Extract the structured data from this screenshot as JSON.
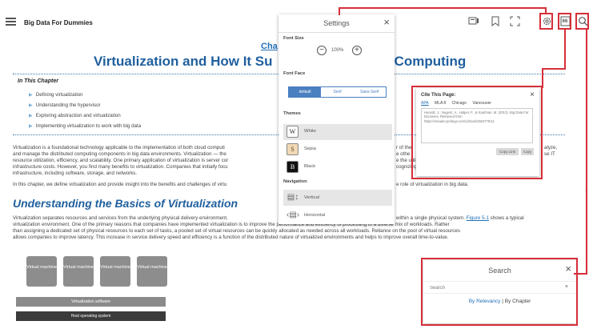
{
  "topbar": {
    "book_title": "Big Data For Dummies",
    "icons": [
      "slides-icon",
      "bookmark-icon",
      "fullscreen-icon",
      "settings-gear-icon",
      "cite-icon",
      "search-icon"
    ],
    "cite_icon_text": "66"
  },
  "chapter": {
    "link_text": "Cha",
    "title": "Virtualization and How It Su",
    "title_tail": "Computing",
    "in_this_chapter": "In This Chapter",
    "toc": [
      "Defining virtualization",
      "Understanding the hypervisor",
      "Exploring abstraction and virtualization",
      "Implementing virtualization to work with big data"
    ],
    "para1": [
      "Virtualization is a foundational technology applicable to the implementation of both cloud computi",
      "and manage the distributed computing components in big data environments. Virtualization — the",
      "resource utilization, efficiency, and scalability. One primary application of virtualization is server cor",
      "infrastructure costs. However, you find many benefits to virtualization. Companies that initially focu",
      "infrastructure, including software, storage, and networks."
    ],
    "para1_right": [
      "r of the",
      "e othe",
      "e the utilization of physical servers and potentially save on",
      "cognizing that it can be applied across the entire IT",
      ""
    ],
    "para1_far_right": [
      "alyze,",
      "se IT",
      "",
      "",
      ""
    ],
    "para2_left": "In this chapter, we define virtualization and provide insight into the benefits and challenges of virtu",
    "para2_right": "e role of virtualization in big data.",
    "section_heading": "Understanding the Basics of Virtualization",
    "para3": [
      "Virtualization separates resources and services from the underlying physical delivery environment.",
      "virtualization environment. One of the primary reasons that companies have implemented virtualization is to improve the performance and efficiency of processing of a diverse mix of workloads. Rather",
      "than assigning a dedicated set of physical resources to each set of tasks, a pooled set of virtual resources can be quickly allocated as needed across all workloads. Reliance on the pool of virtual resources",
      "allows companies to improve latency. This increase in service delivery speed and efficiency is a function of the distributed nature of virtualized environments and helps to improve overall time-to-value."
    ],
    "para3_right_pre": "within a single physical system.",
    "para3_link": "Figure 5-1",
    "para3_right_post": "shows a typical",
    "vm_label": "Virtual machine",
    "vm_boxes": [
      "Virtual machine",
      "Virtual machine",
      "Virtual machine",
      "Virtual machine"
    ],
    "layers": [
      "Virtualization software",
      "Host operating system"
    ]
  },
  "settings": {
    "title": "Settings",
    "font_size_label": "Font Size",
    "font_size_value": "100%",
    "font_face_label": "Font Face",
    "font_faces": [
      "default",
      "Serif",
      "Sans-Serif"
    ],
    "themes_label": "Themes",
    "themes": [
      {
        "swatch": "W",
        "name": "White",
        "bg": "#ffffff",
        "fg": "#222222"
      },
      {
        "swatch": "S",
        "name": "Sepia",
        "bg": "#f1d9b5",
        "fg": "#5a3d1a"
      },
      {
        "swatch": "B",
        "name": "Black",
        "bg": "#111111",
        "fg": "#ffffff"
      }
    ],
    "navigation_label": "Navigation",
    "navigation": [
      "Vertical",
      "Horizontal"
    ]
  },
  "cite": {
    "title": "Cite This Page:",
    "formats": [
      "APA",
      "MLA 8",
      "Chicago",
      "Vancouver"
    ],
    "text": "Hurwitz, J., Nugent, A., Halper, F., & Kaufman, M. (2013). Big Data For Dummies. Retrieved from https://ereader.perlego.com/1/book/1584775/11",
    "buttons": [
      "Copy Link",
      "Copy"
    ]
  },
  "search": {
    "title": "Search",
    "placeholder": "Search",
    "mode_relevancy": "By Relevancy",
    "mode_separator": "|",
    "mode_chapter": "By Chapter"
  },
  "colors": {
    "accent": "#1f5f9e",
    "link": "#1f6fb5",
    "callout": "#d62f3a"
  }
}
